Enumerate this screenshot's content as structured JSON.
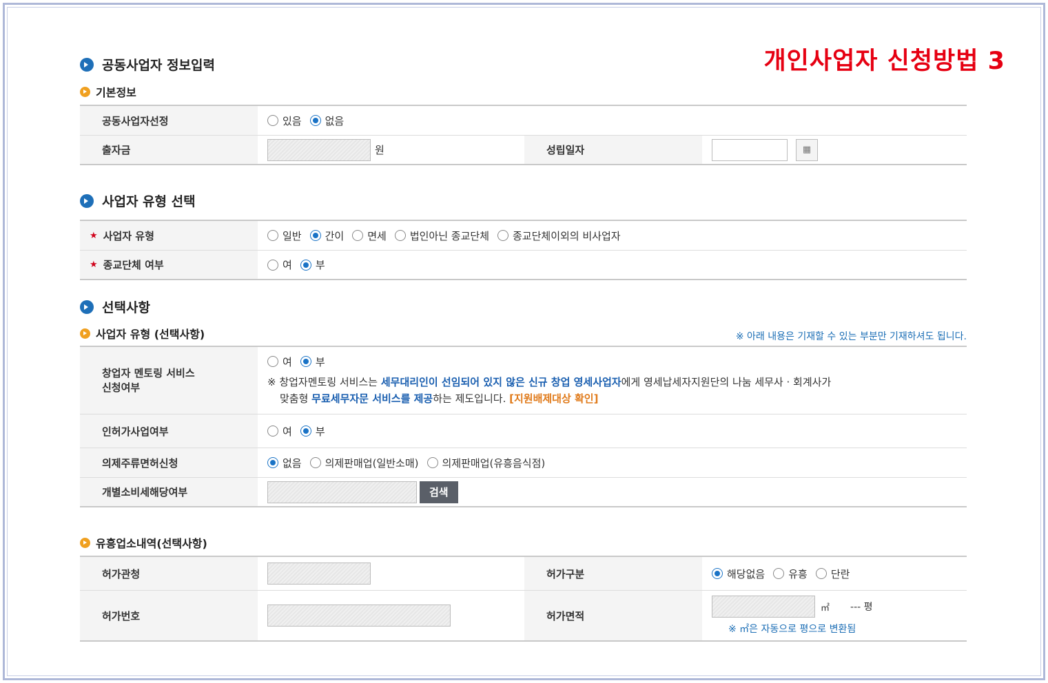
{
  "banner": "개인사업자 신청방법 3",
  "s1": {
    "title": "공동사업자 정보입력",
    "sub": "기본정보",
    "r1_label": "공동사업자선정",
    "r1_opts": [
      "있음",
      "없음"
    ],
    "r1_selected": "없음",
    "r2_label": "출자금",
    "r2_unit": "원",
    "r2_label2": "성립일자"
  },
  "s2": {
    "title": "사업자 유형 선택",
    "r1_label": "사업자 유형",
    "r1_opts": [
      "일반",
      "간이",
      "면세",
      "법인아닌 종교단체",
      "종교단체이외의 비사업자"
    ],
    "r1_selected": "간이",
    "r2_label": "종교단체 여부",
    "r2_opts": [
      "여",
      "부"
    ],
    "r2_selected": "부"
  },
  "s3": {
    "title": "선택사항",
    "sub": "사업자 유형 (선택사항)",
    "note": "※ 아래 내용은 기재할 수 있는 부분만 기재하셔도 됩니다.",
    "r1_label_a": "창업자 멘토링 서비스",
    "r1_label_b": "신청여부",
    "r1_opts": [
      "여",
      "부"
    ],
    "r1_selected": "부",
    "r1_desc_1": "※ 창업자멘토링 서비스는 ",
    "r1_desc_2": "세무대리인이 선임되어 있지 않은 신규 창업 영세사업자",
    "r1_desc_3": "에게 영세납세자지원단의 나눔 세무사 · 회계사가",
    "r1_desc_4": "맞춤형 ",
    "r1_desc_5": "무료세무자문 서비스를 제공",
    "r1_desc_6": "하는 제도입니다. ",
    "r1_desc_7": "[지원배제대상 확인]",
    "r2_label": "인허가사업여부",
    "r2_opts": [
      "여",
      "부"
    ],
    "r2_selected": "부",
    "r3_label": "의제주류면허신청",
    "r3_opts": [
      "없음",
      "의제판매업(일반소매)",
      "의제판매업(유흥음식점)"
    ],
    "r3_selected": "없음",
    "r4_label": "개별소비세해당여부",
    "r4_button": "검색"
  },
  "s4": {
    "sub": "유흥업소내역(선택사항)",
    "r1_label": "허가관청",
    "r1_label2": "허가구분",
    "r1_opts": [
      "해당없음",
      "유흥",
      "단란"
    ],
    "r1_selected": "해당없음",
    "r2_label": "허가번호",
    "r2_label2": "허가면적",
    "r2_unit": "㎡",
    "r2_pyeong": "--- 평",
    "r2_note": "※ ㎡은 자동으로 평으로 변환됨"
  }
}
